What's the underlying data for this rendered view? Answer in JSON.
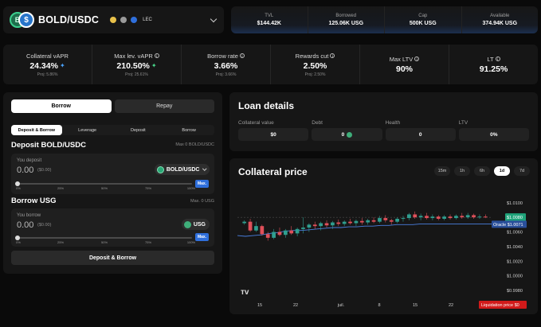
{
  "market": {
    "pair": "BOLD/USDC",
    "logo_a": "B",
    "logo_b": "$",
    "tag": "LEC",
    "icon_colors": [
      "#e8c14a",
      "#9a9a9a",
      "#2f6fdb"
    ]
  },
  "market_stats": [
    {
      "label": "TVL",
      "value": "$144.42K"
    },
    {
      "label": "Borrowed",
      "value": "125.06K USG"
    },
    {
      "label": "Cap",
      "value": "500K USG"
    },
    {
      "label": "Available",
      "value": "374.94K USG"
    }
  ],
  "stats": [
    {
      "label": "Collateral vAPR",
      "value": "24.34%",
      "proj": "Proj: 5.86%",
      "info": false,
      "spark": "✦",
      "spark_color": "#4aa3ff"
    },
    {
      "label": "Max lev. vAPR",
      "value": "210.50%",
      "proj": "Proj: 25.61%",
      "info": true,
      "spark": "✦",
      "spark_color": "#48d68a"
    },
    {
      "label": "Borrow rate",
      "value": "3.66%",
      "proj": "Proj: 3.66%",
      "info": true,
      "spark": "",
      "spark_color": ""
    },
    {
      "label": "Rewards cut",
      "value": "2.50%",
      "proj": "Proj: 2.50%",
      "info": true,
      "spark": "",
      "spark_color": ""
    },
    {
      "label": "Max LTV",
      "value": "90%",
      "proj": "",
      "info": true,
      "spark": "",
      "spark_color": ""
    },
    {
      "label": "LT",
      "value": "91.25%",
      "proj": "",
      "info": true,
      "spark": "",
      "spark_color": ""
    }
  ],
  "tabs": {
    "borrow": "Borrow",
    "repay": "Repay"
  },
  "subtabs": [
    "Deposit & Borrow",
    "Leverage",
    "Deposit",
    "Borrow"
  ],
  "deposit": {
    "title": "Deposit BOLD/USDC",
    "max_text": "Max 0 BOLD/USDC",
    "label": "You deposit",
    "amount": "0.00",
    "usd": "($0.00)",
    "token": "BOLD/USDC",
    "max": "Max."
  },
  "borrow": {
    "title": "Borrow USG",
    "max_text": "Max. 0 USG",
    "label": "You borrow",
    "amount": "0.00",
    "usd": "($0.00)",
    "token": "USG",
    "max": "Max."
  },
  "slider_ticks": [
    "0%",
    "25%",
    "50%",
    "75%",
    "100%"
  ],
  "action_button": "Deposit & Borrow",
  "loan": {
    "title": "Loan details",
    "cols": [
      {
        "label": "Collateral value",
        "value": "$0",
        "icon": false
      },
      {
        "label": "Debt",
        "value": "0",
        "icon": true
      },
      {
        "label": "Health",
        "value": "0",
        "icon": false
      },
      {
        "label": "LTV",
        "value": "0%",
        "icon": false
      }
    ]
  },
  "price": {
    "title": "Collateral price",
    "timeframes": [
      "15m",
      "1h",
      "6h",
      "1d",
      "7d"
    ],
    "active_tf": "1d",
    "current_price_label": "$1.0080",
    "oracle_label": "Oracle $1.0071",
    "liquidation_label": "Liquidation price $0",
    "colors": {
      "up": "#2f9e8f",
      "down": "#e0505a",
      "oracle": "#4a7fe0",
      "last": "#1fa37a",
      "liq": "#d11a1a"
    }
  },
  "chart_data": {
    "type": "candlestick",
    "y_ticks": [
      "$1.0100",
      "$1.0080",
      "$1.0060",
      "$1.0040",
      "$1.0020",
      "$1.0000",
      "$0.9980"
    ],
    "ylim": [
      0.998,
      1.0115
    ],
    "x_ticks": [
      "15",
      "22",
      "juil.",
      "8",
      "15",
      "22"
    ],
    "candles": [
      {
        "o": 1.0072,
        "h": 1.0076,
        "l": 1.007,
        "c": 1.0074
      },
      {
        "o": 1.0074,
        "h": 1.0078,
        "l": 1.006,
        "c": 1.0062
      },
      {
        "o": 1.0062,
        "h": 1.0074,
        "l": 1.006,
        "c": 1.0068
      },
      {
        "o": 1.0068,
        "h": 1.007,
        "l": 1.0055,
        "c": 1.0057
      },
      {
        "o": 1.0057,
        "h": 1.006,
        "l": 1.0048,
        "c": 1.0052
      },
      {
        "o": 1.0052,
        "h": 1.0064,
        "l": 1.005,
        "c": 1.006
      },
      {
        "o": 1.006,
        "h": 1.0066,
        "l": 1.0054,
        "c": 1.0056
      },
      {
        "o": 1.0056,
        "h": 1.0064,
        "l": 1.0052,
        "c": 1.0062
      },
      {
        "o": 1.0062,
        "h": 1.0068,
        "l": 1.0056,
        "c": 1.0058
      },
      {
        "o": 1.0058,
        "h": 1.0066,
        "l": 1.0054,
        "c": 1.0064
      },
      {
        "o": 1.0064,
        "h": 1.008,
        "l": 1.0058,
        "c": 1.0066
      },
      {
        "o": 1.0066,
        "h": 1.0072,
        "l": 1.006,
        "c": 1.007
      },
      {
        "o": 1.007,
        "h": 1.0074,
        "l": 1.0064,
        "c": 1.0068
      },
      {
        "o": 1.0068,
        "h": 1.0074,
        "l": 1.0062,
        "c": 1.0072
      },
      {
        "o": 1.0072,
        "h": 1.0076,
        "l": 1.0066,
        "c": 1.0069
      },
      {
        "o": 1.0069,
        "h": 1.0075,
        "l": 1.0064,
        "c": 1.0073
      },
      {
        "o": 1.0073,
        "h": 1.0077,
        "l": 1.0068,
        "c": 1.0071
      },
      {
        "o": 1.0071,
        "h": 1.0076,
        "l": 1.0068,
        "c": 1.0074
      },
      {
        "o": 1.0074,
        "h": 1.0078,
        "l": 1.007,
        "c": 1.0072
      },
      {
        "o": 1.0072,
        "h": 1.0077,
        "l": 1.0068,
        "c": 1.0075
      },
      {
        "o": 1.0075,
        "h": 1.0079,
        "l": 1.007,
        "c": 1.0073
      },
      {
        "o": 1.0073,
        "h": 1.0078,
        "l": 1.007,
        "c": 1.0076
      },
      {
        "o": 1.0076,
        "h": 1.008,
        "l": 1.0072,
        "c": 1.0074
      },
      {
        "o": 1.0074,
        "h": 1.0082,
        "l": 1.0072,
        "c": 1.0079
      },
      {
        "o": 1.0079,
        "h": 1.0083,
        "l": 1.0073,
        "c": 1.0076
      },
      {
        "o": 1.0076,
        "h": 1.0078,
        "l": 1.007,
        "c": 1.0074
      },
      {
        "o": 1.0074,
        "h": 1.008,
        "l": 1.0072,
        "c": 1.0078
      },
      {
        "o": 1.0078,
        "h": 1.0082,
        "l": 1.0074,
        "c": 1.0079
      },
      {
        "o": 1.0079,
        "h": 1.0086,
        "l": 1.0076,
        "c": 1.0084
      },
      {
        "o": 1.0084,
        "h": 1.0088,
        "l": 1.0078,
        "c": 1.008
      },
      {
        "o": 1.008,
        "h": 1.0085,
        "l": 1.0076,
        "c": 1.0082
      },
      {
        "o": 1.0082,
        "h": 1.0086,
        "l": 1.0077,
        "c": 1.0079
      },
      {
        "o": 1.0079,
        "h": 1.0084,
        "l": 1.0076,
        "c": 1.0081
      },
      {
        "o": 1.0081,
        "h": 1.0083,
        "l": 1.0076,
        "c": 1.0078
      },
      {
        "o": 1.0078,
        "h": 1.0083,
        "l": 1.0076,
        "c": 1.0081
      },
      {
        "o": 1.0081,
        "h": 1.0084,
        "l": 1.0077,
        "c": 1.0079
      },
      {
        "o": 1.0079,
        "h": 1.0084,
        "l": 1.0077,
        "c": 1.0082
      },
      {
        "o": 1.0082,
        "h": 1.0086,
        "l": 1.0078,
        "c": 1.008
      },
      {
        "o": 1.008,
        "h": 1.0086,
        "l": 1.0078,
        "c": 1.0083
      },
      {
        "o": 1.0083,
        "h": 1.0085,
        "l": 1.0078,
        "c": 1.008
      },
      {
        "o": 1.008,
        "h": 1.0084,
        "l": 1.0078,
        "c": 1.0081
      },
      {
        "o": 1.0081,
        "h": 1.0084,
        "l": 1.0079,
        "c": 1.008
      }
    ],
    "oracle": [
      1.0055,
      1.0054,
      1.0055,
      1.0056,
      1.0058,
      1.0059,
      1.0061,
      1.0062,
      1.0062,
      1.0063,
      1.0064,
      1.0065,
      1.0066,
      1.0066,
      1.0067,
      1.0067,
      1.0068,
      1.0068,
      1.0069,
      1.0069,
      1.007,
      1.007,
      1.007,
      1.0071,
      1.0071,
      1.0071,
      1.0071,
      1.0071,
      1.0071,
      1.0071,
      1.0071,
      1.0071,
      1.0071
    ]
  }
}
